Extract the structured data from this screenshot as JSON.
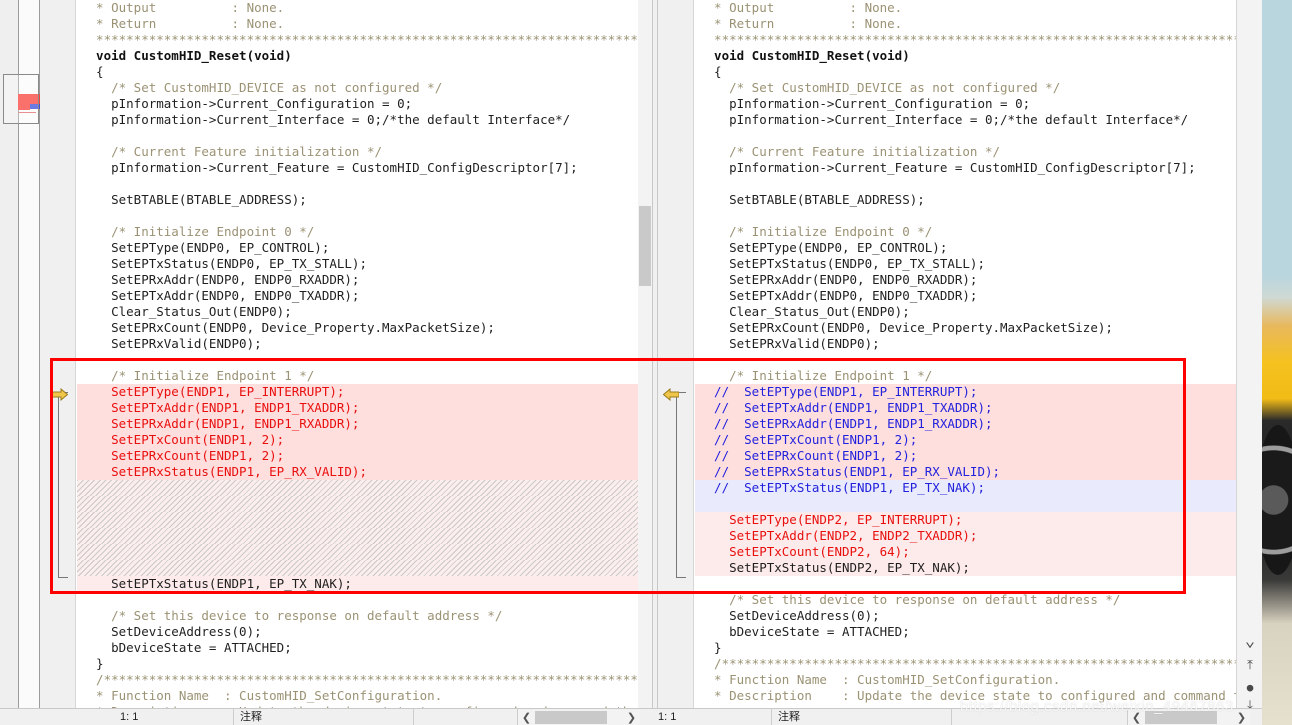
{
  "app": {
    "watermark": "https://blog.csdn.net/weixin_49467863"
  },
  "statusbar": {
    "left": {
      "position": "1: 1",
      "mode": "注释",
      "extra": ""
    },
    "right": {
      "position": "1: 1",
      "mode": "注释",
      "extra": ""
    },
    "scroll_left_arrow": "❮",
    "scroll_right_arrow": "❯"
  },
  "navcol": {
    "items": [
      {
        "name": "chevron-down-icon",
        "glyph": "⌄"
      },
      {
        "name": "goto-first-change-icon",
        "glyph": "⤒"
      },
      {
        "name": "current-change-icon",
        "glyph": "●"
      },
      {
        "name": "goto-last-change-icon",
        "glyph": "⤓"
      }
    ]
  },
  "overview": {
    "label": "diff-overview-minimap"
  },
  "left_pane": {
    "title": "left-diff-pane",
    "lines": [
      {
        "t": "  * Output          : None.",
        "cls": "cmt",
        "bg": ""
      },
      {
        "t": "  * Return          : None.",
        "cls": "cmt",
        "bg": ""
      },
      {
        "t": "  *******************************************************************************",
        "cls": "stars",
        "bg": ""
      },
      {
        "t": "  void CustomHID_Reset(void)",
        "cls": "kw",
        "bg": ""
      },
      {
        "t": "  {",
        "cls": "plain",
        "bg": ""
      },
      {
        "t": "    /* Set CustomHID_DEVICE as not configured */",
        "cls": "cmt",
        "bg": ""
      },
      {
        "t": "    pInformation->Current_Configuration = 0;",
        "cls": "plain",
        "bg": ""
      },
      {
        "t": "    pInformation->Current_Interface = 0;/*the default Interface*/",
        "cls": "plain",
        "bg": ""
      },
      {
        "t": "",
        "cls": "plain",
        "bg": ""
      },
      {
        "t": "    /* Current Feature initialization */",
        "cls": "cmt",
        "bg": ""
      },
      {
        "t": "    pInformation->Current_Feature = CustomHID_ConfigDescriptor[7];",
        "cls": "plain",
        "bg": ""
      },
      {
        "t": "",
        "cls": "plain",
        "bg": ""
      },
      {
        "t": "    SetBTABLE(BTABLE_ADDRESS);",
        "cls": "plain",
        "bg": ""
      },
      {
        "t": "",
        "cls": "plain",
        "bg": ""
      },
      {
        "t": "    /* Initialize Endpoint 0 */",
        "cls": "cmt",
        "bg": ""
      },
      {
        "t": "    SetEPType(ENDP0, EP_CONTROL);",
        "cls": "plain",
        "bg": ""
      },
      {
        "t": "    SetEPTxStatus(ENDP0, EP_TX_STALL);",
        "cls": "plain",
        "bg": ""
      },
      {
        "t": "    SetEPRxAddr(ENDP0, ENDP0_RXADDR);",
        "cls": "plain",
        "bg": ""
      },
      {
        "t": "    SetEPTxAddr(ENDP0, ENDP0_TXADDR);",
        "cls": "plain",
        "bg": ""
      },
      {
        "t": "    Clear_Status_Out(ENDP0);",
        "cls": "plain",
        "bg": ""
      },
      {
        "t": "    SetEPRxCount(ENDP0, Device_Property.MaxPacketSize);",
        "cls": "plain",
        "bg": ""
      },
      {
        "t": "    SetEPRxValid(ENDP0);",
        "cls": "plain",
        "bg": ""
      },
      {
        "t": "",
        "cls": "plain",
        "bg": ""
      },
      {
        "t": "    /* Initialize Endpoint 1 */",
        "cls": "cmt",
        "bg": ""
      },
      {
        "t": "    SetEPType(ENDP1, EP_INTERRUPT);",
        "cls": "txt-red",
        "bg": "bg-changed"
      },
      {
        "t": "    SetEPTxAddr(ENDP1, ENDP1_TXADDR);",
        "cls": "txt-red",
        "bg": "bg-changed"
      },
      {
        "t": "    SetEPRxAddr(ENDP1, ENDP1_RXADDR);",
        "cls": "txt-red",
        "bg": "bg-changed"
      },
      {
        "t": "    SetEPTxCount(ENDP1, 2);",
        "cls": "txt-red",
        "bg": "bg-changed"
      },
      {
        "t": "    SetEPRxCount(ENDP1, 2);",
        "cls": "txt-red",
        "bg": "bg-changed"
      },
      {
        "t": "    SetEPRxStatus(ENDP1, EP_RX_VALID);",
        "cls": "txt-red",
        "bg": "bg-changed"
      },
      {
        "t": "",
        "cls": "plain",
        "bg": "bg-filler"
      },
      {
        "t": "",
        "cls": "plain",
        "bg": "bg-filler"
      },
      {
        "t": "",
        "cls": "plain",
        "bg": "bg-filler"
      },
      {
        "t": "",
        "cls": "plain",
        "bg": "bg-filler"
      },
      {
        "t": "",
        "cls": "plain",
        "bg": "bg-filler"
      },
      {
        "t": "",
        "cls": "plain",
        "bg": "bg-filler"
      },
      {
        "t": "    SetEPTxStatus(ENDP1, EP_TX_NAK);",
        "cls": "plain",
        "bg": "bg-changed-soft"
      },
      {
        "t": "",
        "cls": "plain",
        "bg": ""
      },
      {
        "t": "    /* Set this device to response on default address */",
        "cls": "cmt",
        "bg": ""
      },
      {
        "t": "    SetDeviceAddress(0);",
        "cls": "plain",
        "bg": ""
      },
      {
        "t": "    bDeviceState = ATTACHED;",
        "cls": "plain",
        "bg": ""
      },
      {
        "t": "  }",
        "cls": "plain",
        "bg": ""
      },
      {
        "t": "  /*******************************************************************************",
        "cls": "stars",
        "bg": ""
      },
      {
        "t": "  * Function Name  : CustomHID_SetConfiguration.",
        "cls": "cmt",
        "bg": ""
      },
      {
        "t": "  * Description    : Update the device state to configured and command the ADC",
        "cls": "cmt",
        "bg": ""
      }
    ]
  },
  "right_pane": {
    "title": "right-diff-pane",
    "lines": [
      {
        "t": "  * Output          : None.",
        "cls": "cmt",
        "bg": ""
      },
      {
        "t": "  * Return          : None.",
        "cls": "cmt",
        "bg": ""
      },
      {
        "t": "  *******************************************************************************",
        "cls": "stars",
        "bg": ""
      },
      {
        "t": "  void CustomHID_Reset(void)",
        "cls": "kw",
        "bg": ""
      },
      {
        "t": "  {",
        "cls": "plain",
        "bg": ""
      },
      {
        "t": "    /* Set CustomHID_DEVICE as not configured */",
        "cls": "cmt",
        "bg": ""
      },
      {
        "t": "    pInformation->Current_Configuration = 0;",
        "cls": "plain",
        "bg": ""
      },
      {
        "t": "    pInformation->Current_Interface = 0;/*the default Interface*/",
        "cls": "plain",
        "bg": ""
      },
      {
        "t": "",
        "cls": "plain",
        "bg": ""
      },
      {
        "t": "    /* Current Feature initialization */",
        "cls": "cmt",
        "bg": ""
      },
      {
        "t": "    pInformation->Current_Feature = CustomHID_ConfigDescriptor[7];",
        "cls": "plain",
        "bg": ""
      },
      {
        "t": "",
        "cls": "plain",
        "bg": ""
      },
      {
        "t": "    SetBTABLE(BTABLE_ADDRESS);",
        "cls": "plain",
        "bg": ""
      },
      {
        "t": "",
        "cls": "plain",
        "bg": ""
      },
      {
        "t": "    /* Initialize Endpoint 0 */",
        "cls": "cmt",
        "bg": ""
      },
      {
        "t": "    SetEPType(ENDP0, EP_CONTROL);",
        "cls": "plain",
        "bg": ""
      },
      {
        "t": "    SetEPTxStatus(ENDP0, EP_TX_STALL);",
        "cls": "plain",
        "bg": ""
      },
      {
        "t": "    SetEPRxAddr(ENDP0, ENDP0_RXADDR);",
        "cls": "plain",
        "bg": ""
      },
      {
        "t": "    SetEPTxAddr(ENDP0, ENDP0_TXADDR);",
        "cls": "plain",
        "bg": ""
      },
      {
        "t": "    Clear_Status_Out(ENDP0);",
        "cls": "plain",
        "bg": ""
      },
      {
        "t": "    SetEPRxCount(ENDP0, Device_Property.MaxPacketSize);",
        "cls": "plain",
        "bg": ""
      },
      {
        "t": "    SetEPRxValid(ENDP0);",
        "cls": "plain",
        "bg": ""
      },
      {
        "t": "",
        "cls": "plain",
        "bg": ""
      },
      {
        "t": "    /* Initialize Endpoint 1 */",
        "cls": "cmt",
        "bg": ""
      },
      {
        "t": "  //  SetEPType(ENDP1, EP_INTERRUPT);",
        "cls": "txt-blue",
        "bg": "bg-changed"
      },
      {
        "t": "  //  SetEPTxAddr(ENDP1, ENDP1_TXADDR);",
        "cls": "txt-blue",
        "bg": "bg-changed"
      },
      {
        "t": "  //  SetEPRxAddr(ENDP1, ENDP1_RXADDR);",
        "cls": "txt-blue",
        "bg": "bg-changed"
      },
      {
        "t": "  //  SetEPTxCount(ENDP1, 2);",
        "cls": "txt-blue",
        "bg": "bg-changed"
      },
      {
        "t": "  //  SetEPRxCount(ENDP1, 2);",
        "cls": "txt-blue",
        "bg": "bg-changed"
      },
      {
        "t": "  //  SetEPRxStatus(ENDP1, EP_RX_VALID);",
        "cls": "txt-blue",
        "bg": "bg-changed"
      },
      {
        "t": "  //  SetEPTxStatus(ENDP1, EP_TX_NAK);",
        "cls": "txt-blue",
        "bg": "bg-blue"
      },
      {
        "t": "",
        "cls": "plain",
        "bg": "bg-blue"
      },
      {
        "t": "    SetEPType(ENDP2, EP_INTERRUPT);",
        "cls": "txt-red",
        "bg": "bg-changed-soft"
      },
      {
        "t": "    SetEPTxAddr(ENDP2, ENDP2_TXADDR);",
        "cls": "txt-red",
        "bg": "bg-changed-soft"
      },
      {
        "t": "    SetEPTxCount(ENDP2, 64);",
        "cls": "txt-red",
        "bg": "bg-changed-soft"
      },
      {
        "t": "    SetEPTxStatus(ENDP2, EP_TX_NAK);",
        "cls": "plain",
        "bg": "bg-changed-soft"
      },
      {
        "t": "",
        "cls": "plain",
        "bg": ""
      },
      {
        "t": "    /* Set this device to response on default address */",
        "cls": "cmt",
        "bg": ""
      },
      {
        "t": "    SetDeviceAddress(0);",
        "cls": "plain",
        "bg": ""
      },
      {
        "t": "    bDeviceState = ATTACHED;",
        "cls": "plain",
        "bg": ""
      },
      {
        "t": "  }",
        "cls": "plain",
        "bg": ""
      },
      {
        "t": "  /*******************************************************************************",
        "cls": "stars",
        "bg": ""
      },
      {
        "t": "  * Function Name  : CustomHID_SetConfiguration.",
        "cls": "cmt",
        "bg": ""
      },
      {
        "t": "  * Description    : Update the device state to configured and command the ADC",
        "cls": "cmt",
        "bg": ""
      }
    ]
  },
  "colors": {
    "diff_outline": "#ff0000",
    "changed_bg": "#ffdede",
    "blue_bg": "#e9eafb",
    "deleted_text": "#e8100f",
    "comment_text": "#2222dd",
    "marker_arrow": "#f0c64a"
  }
}
